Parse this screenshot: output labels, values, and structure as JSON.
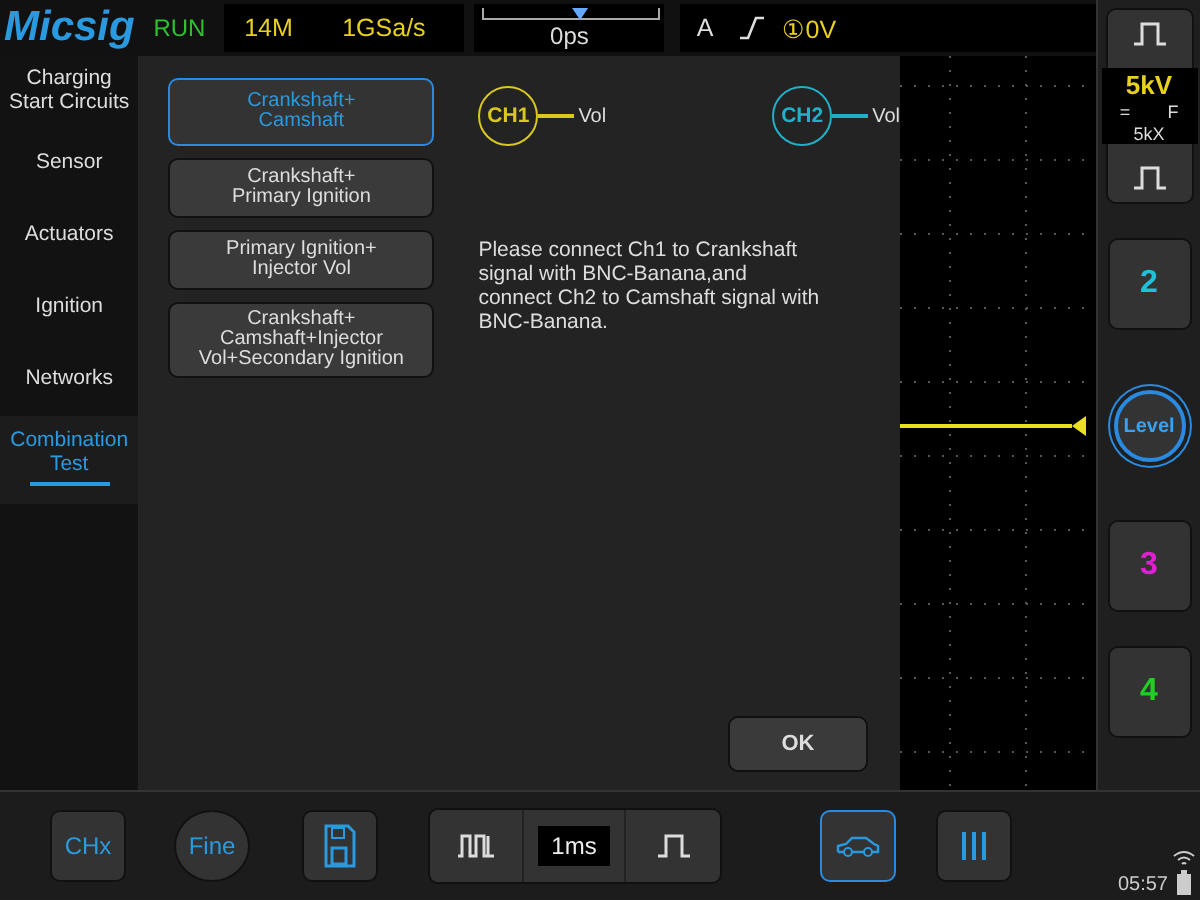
{
  "header": {
    "logo": "Micsig",
    "run_state": "RUN",
    "memory_depth": "14M",
    "sample_rate": "1GSa/s",
    "time_offset": "0ps",
    "trigger_source": "A",
    "trigger_level": "①0V"
  },
  "categories": [
    {
      "label": "Charging\nStart Circuits",
      "selected": false
    },
    {
      "label": "Sensor",
      "selected": false
    },
    {
      "label": "Actuators",
      "selected": false
    },
    {
      "label": "Ignition",
      "selected": false
    },
    {
      "label": "Networks",
      "selected": false
    },
    {
      "label": "Combination\nTest",
      "selected": true
    }
  ],
  "tests": [
    {
      "label": "Crankshaft+\nCamshaft",
      "selected": true
    },
    {
      "label": "Crankshaft+\nPrimary Ignition",
      "selected": false
    },
    {
      "label": "Primary Ignition+\nInjector Vol",
      "selected": false
    },
    {
      "label": "Crankshaft+\nCamshaft+Injector\nVol+Secondary Ignition",
      "selected": false
    }
  ],
  "probes": [
    {
      "channel": "CH1",
      "signal": "Vol",
      "color": "#d8c820"
    },
    {
      "channel": "CH2",
      "signal": "Vol",
      "color": "#20b0c8"
    }
  ],
  "instructions": "Please connect Ch1 to Crankshaft\nsignal with BNC-Banana,and\nconnect Ch2 to Camshaft signal with\nBNC-Banana.",
  "ok_button": "OK",
  "ch1_panel": {
    "scale": "5kV",
    "coupling": "=",
    "bandwidth": "F",
    "probe": "5kX"
  },
  "channel_buttons": [
    {
      "label": "2",
      "color": "#20c0d8"
    },
    {
      "label": "3",
      "color": "#e020d0"
    },
    {
      "label": "4",
      "color": "#20d020"
    }
  ],
  "level_button": "Level",
  "bottom_bar": {
    "ch_button": "CHx",
    "fine_button": "Fine",
    "timebase": "1ms",
    "auto_mode_selected": true,
    "clock": "05:57"
  }
}
